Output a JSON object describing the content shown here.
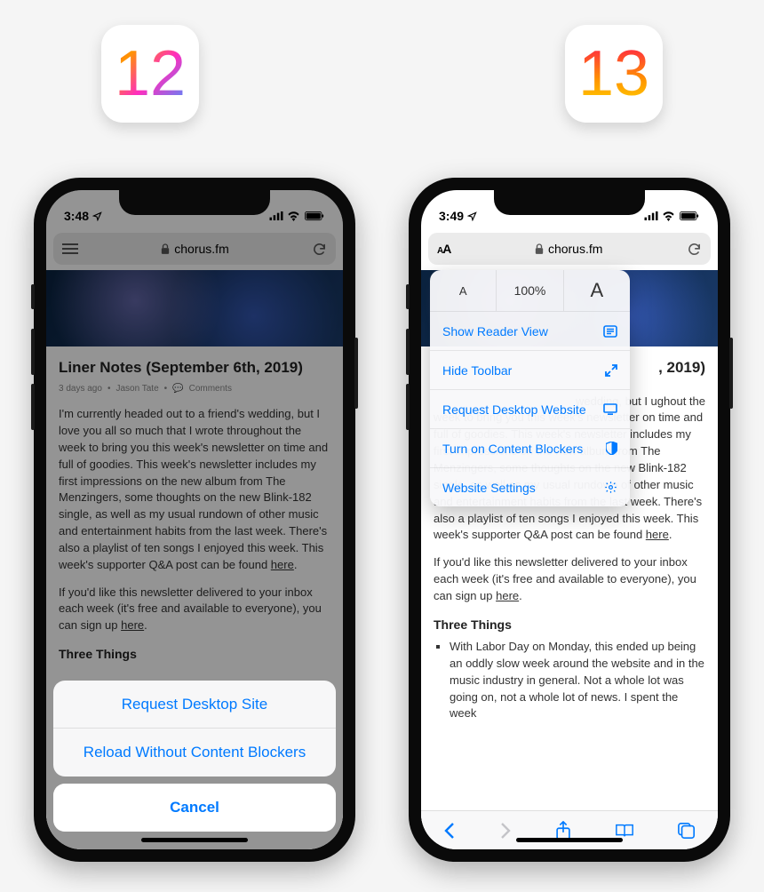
{
  "badges": {
    "ios12": "12",
    "ios13": "13"
  },
  "status12": {
    "time": "3:48",
    "icons": "◂"
  },
  "status13": {
    "time": "3:49",
    "icons": "◂"
  },
  "addr12": {
    "domain": "chorus.fm"
  },
  "addr13": {
    "domain": "chorus.fm"
  },
  "article": {
    "title": "Liner Notes (September 6th, 2019)",
    "meta_age": "3 days ago",
    "meta_author": "Jason Tate",
    "meta_comments": "Comments",
    "p1": "I'm currently headed out to a friend's wedding, but I love you all so much that I wrote throughout the week to bring you this week's newsletter on time and full of goodies. This week's newsletter includes my first impressions on the new album from The Menzingers, some thoughts on the new Blink-182 single, as well as my usual rundown of other music and entertainment habits from the last week. There's also a playlist of ten songs I enjoyed this week. This week's supporter Q&A post can be found ",
    "p1_link": "here",
    "p2": "If you'd like this newsletter delivered to your inbox each week (it's free and available to everyone), you can sign up ",
    "p2_link": "here",
    "subhead": "Three Things",
    "li1": "With Labor Day on Monday, this ended up being an oddly slow week around the website and in the music industry in general. Not a whole lot was going on, not a whole lot of news. I spent the week"
  },
  "article13_title_tail": ", 2019)",
  "article13_p1_lead": "wedding, but I ughout the",
  "actionsheet": {
    "opt1": "Request Desktop Site",
    "opt2": "Reload Without Content Blockers",
    "cancel": "Cancel"
  },
  "popover": {
    "zoom": "100%",
    "reader": "Show Reader View",
    "hide_toolbar": "Hide Toolbar",
    "desktop": "Request Desktop Website",
    "blockers": "Turn on Content Blockers",
    "settings": "Website Settings"
  }
}
